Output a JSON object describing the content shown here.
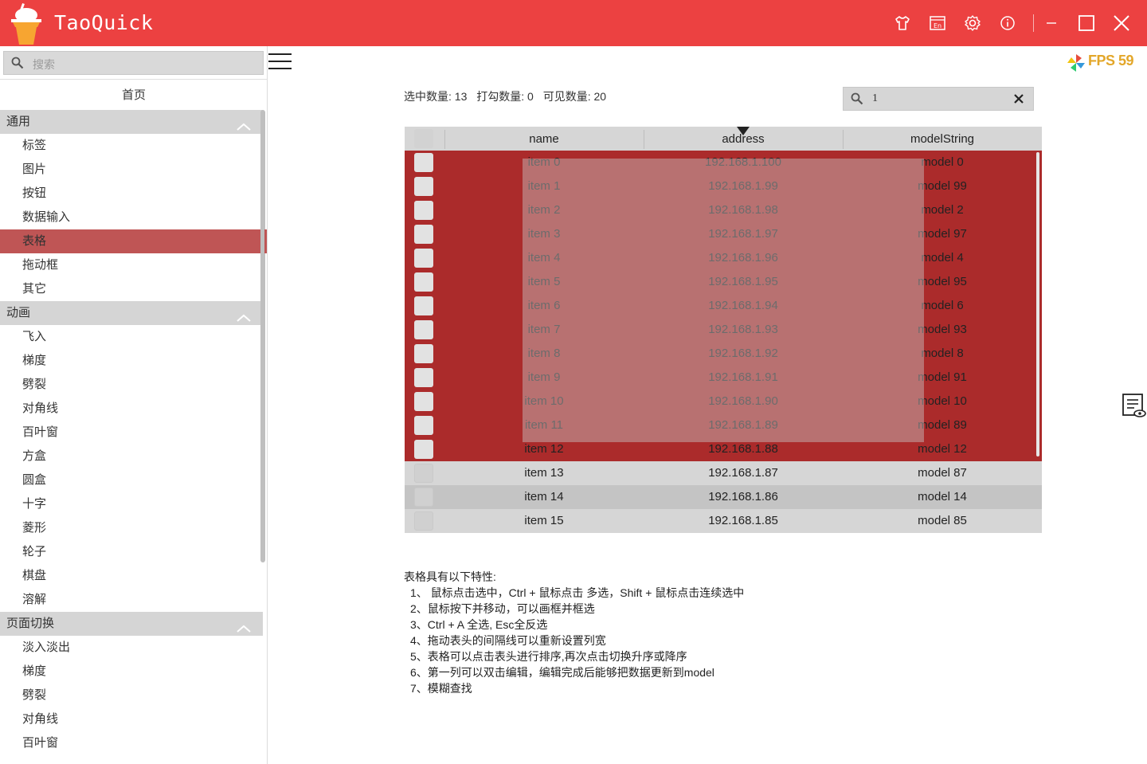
{
  "app": {
    "title": "TaoQuick",
    "accent": "#ec4141",
    "titlebar_icons": [
      "skin-icon",
      "language-icon",
      "settings-icon",
      "info-icon",
      "minimize-icon",
      "maximize-icon",
      "close-icon"
    ],
    "language_badge": "En"
  },
  "sidebar": {
    "search_placeholder": "搜索",
    "home": "首页",
    "groups": [
      {
        "label": "通用",
        "items": [
          "标签",
          "图片",
          "按钮",
          "数据输入",
          "表格",
          "拖动框",
          "其它"
        ]
      },
      {
        "label": "动画",
        "items": [
          "飞入",
          "梯度",
          "劈裂",
          "对角线",
          "百叶窗",
          "方盒",
          "圆盒",
          "十字",
          "菱形",
          "轮子",
          "棋盘",
          "溶解"
        ]
      },
      {
        "label": "页面切换",
        "items": [
          "淡入淡出",
          "梯度",
          "劈裂",
          "对角线",
          "百叶窗"
        ]
      }
    ],
    "active_item": "表格"
  },
  "fps": {
    "label": "FPS 59"
  },
  "stats": {
    "selected": "选中数量: 13",
    "checked": "打勾数量: 0",
    "visible": "可见数量: 20"
  },
  "filter": {
    "value": "1"
  },
  "table": {
    "columns": [
      "name",
      "address",
      "modelString"
    ],
    "sort_column": "address",
    "rows": [
      {
        "name": "item 0",
        "address": "192.168.1.100",
        "model": "model 0",
        "state": "selected"
      },
      {
        "name": "item 1",
        "address": "192.168.1.99",
        "model": "model 99",
        "state": "selected"
      },
      {
        "name": "item 2",
        "address": "192.168.1.98",
        "model": "model 2",
        "state": "selected"
      },
      {
        "name": "item 3",
        "address": "192.168.1.97",
        "model": "model 97",
        "state": "selected"
      },
      {
        "name": "item 4",
        "address": "192.168.1.96",
        "model": "model 4",
        "state": "selected"
      },
      {
        "name": "item 5",
        "address": "192.168.1.95",
        "model": "model 95",
        "state": "selected"
      },
      {
        "name": "item 6",
        "address": "192.168.1.94",
        "model": "model 6",
        "state": "selected"
      },
      {
        "name": "item 7",
        "address": "192.168.1.93",
        "model": "model 93",
        "state": "selected"
      },
      {
        "name": "item 8",
        "address": "192.168.1.92",
        "model": "model 8",
        "state": "selected"
      },
      {
        "name": "item 9",
        "address": "192.168.1.91",
        "model": "model 91",
        "state": "selected"
      },
      {
        "name": "item 10",
        "address": "192.168.1.90",
        "model": "model 10",
        "state": "selected"
      },
      {
        "name": "item 11",
        "address": "192.168.1.89",
        "model": "model 89",
        "state": "selected"
      },
      {
        "name": "item 12",
        "address": "192.168.1.88",
        "model": "model 12",
        "state": "selected"
      },
      {
        "name": "item 13",
        "address": "192.168.1.87",
        "model": "model 87",
        "state": "normal"
      },
      {
        "name": "item 14",
        "address": "192.168.1.86",
        "model": "model 14",
        "state": "hover"
      },
      {
        "name": "item 15",
        "address": "192.168.1.85",
        "model": "model 85",
        "state": "normal"
      }
    ]
  },
  "notes": {
    "heading": "表格具有以下特性:",
    "lines": [
      "1、 鼠标点击选中，Ctrl + 鼠标点击 多选，Shift + 鼠标点击连续选中",
      "2、鼠标按下并移动，可以画框并框选",
      "3、Ctrl + A 全选, Esc全反选",
      "4、拖动表头的间隔线可以重新设置列宽",
      "5、表格可以点击表头进行排序,再次点击切换升序或降序",
      "6、第一列可以双击编辑，编辑完成后能够把数据更新到model",
      "7、模糊查找"
    ]
  }
}
